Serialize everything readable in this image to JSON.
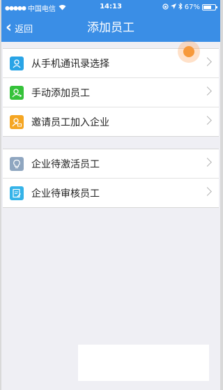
{
  "status_bar": {
    "carrier": "中国电信",
    "time": "14:13",
    "battery_percent": "67%",
    "battery_level": 0.67
  },
  "nav": {
    "back_label": "返回",
    "title": "添加员工"
  },
  "group1": [
    {
      "label": "从手机通讯录选择",
      "icon": "contacts-icon",
      "color": "#29a4e6"
    },
    {
      "label": "手动添加员工",
      "icon": "add-person-icon",
      "color": "#35c23a"
    },
    {
      "label": "邀请员工加入企业",
      "icon": "invite-icon",
      "color": "#f5a623"
    }
  ],
  "group2": [
    {
      "label": "企业待激活员工",
      "icon": "lightbulb-icon",
      "color": "#8fa6c0"
    },
    {
      "label": "企业待审核员工",
      "icon": "review-icon",
      "color": "#35b3e8"
    }
  ],
  "colors": {
    "accent": "#3a8ee6",
    "background": "#efeff4"
  }
}
